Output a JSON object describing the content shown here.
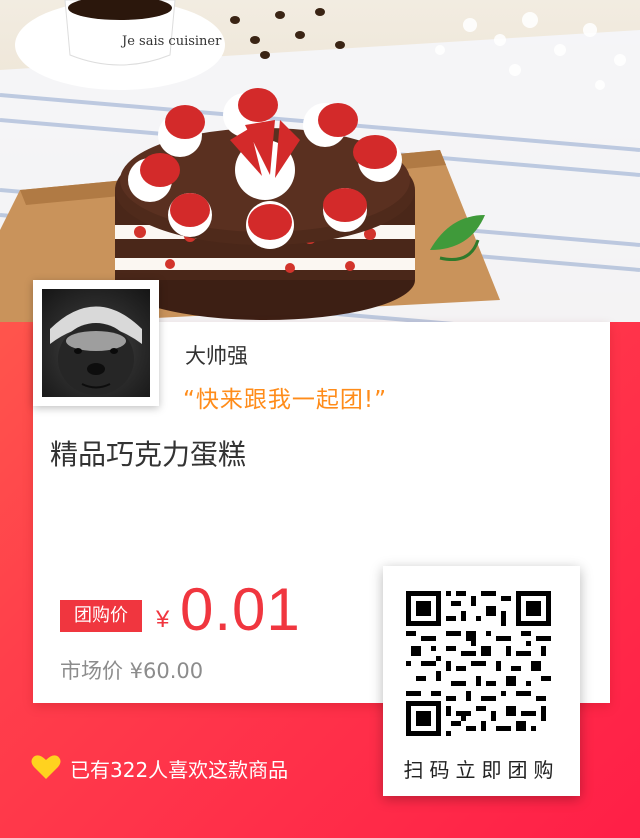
{
  "colors": {
    "accent_red": "#f0363f",
    "slogan_orange": "#ff8c1a",
    "heart_yellow": "#ffd21f",
    "background_gradient": [
      "#ff6a4d",
      "#ff1f47"
    ]
  },
  "hero": {
    "image": "chocolate-strawberry-cake-photo",
    "cup_text": "Je sais cuisiner"
  },
  "user": {
    "avatar": "honey-badger-avatar",
    "nickname": "大帅强",
    "slogan": "“快来跟我一起团!”"
  },
  "product": {
    "title": "精品巧克力蛋糕",
    "group_badge": "团购价",
    "currency_symbol": "¥",
    "group_price": "0.01",
    "market_price_label": "市场价 ¥60.00"
  },
  "qr": {
    "icon": "qr-code-icon",
    "label": "扫码立即团购"
  },
  "footer": {
    "icon": "heart-icon",
    "likes_text": "已有322人喜欢这款商品"
  }
}
